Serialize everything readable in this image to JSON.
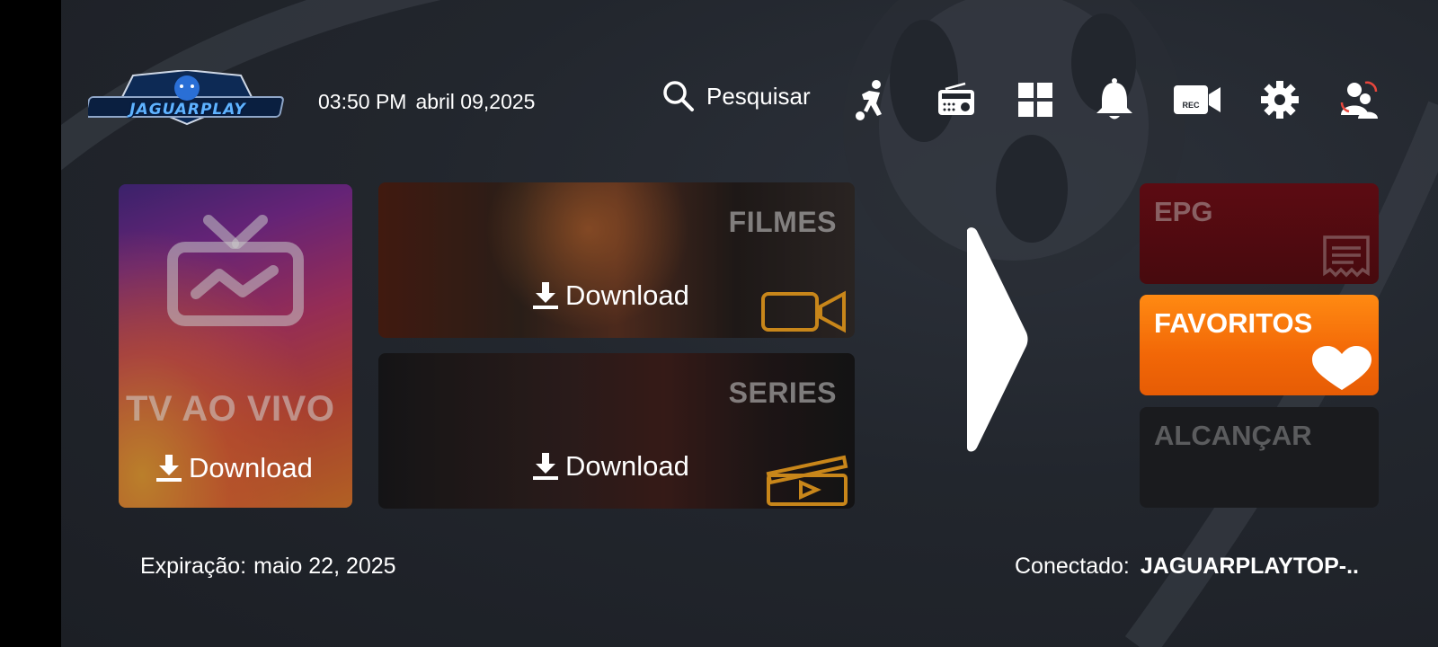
{
  "header": {
    "logo_text": "JAGUARPLAY",
    "time": "03:50 PM",
    "date": "abril 09,2025",
    "search_label": "Pesquisar",
    "icons": [
      "soccer-player-icon",
      "radio-icon",
      "grid-apps-icon",
      "bell-icon",
      "rec-camera-icon",
      "gear-icon",
      "switch-user-icon"
    ],
    "rec_label": "REC"
  },
  "cards": {
    "live_tv": {
      "title": "TV AO VIVO",
      "download_label": "Download"
    },
    "movies": {
      "title": "FILMES",
      "download_label": "Download"
    },
    "series": {
      "title": "SERIES",
      "download_label": "Download"
    }
  },
  "side": {
    "epg": "EPG",
    "favorites": "FAVORITOS",
    "reach": "ALCANÇAR"
  },
  "footer": {
    "expiry_label": "Expiração:",
    "expiry_date": "maio 22, 2025",
    "connected_label": "Conectado:",
    "connected_value": "JAGUARPLAYTOP-.."
  },
  "colors": {
    "background": "#22262d",
    "favorites": "#f26707",
    "epg": "#4f0b10"
  }
}
